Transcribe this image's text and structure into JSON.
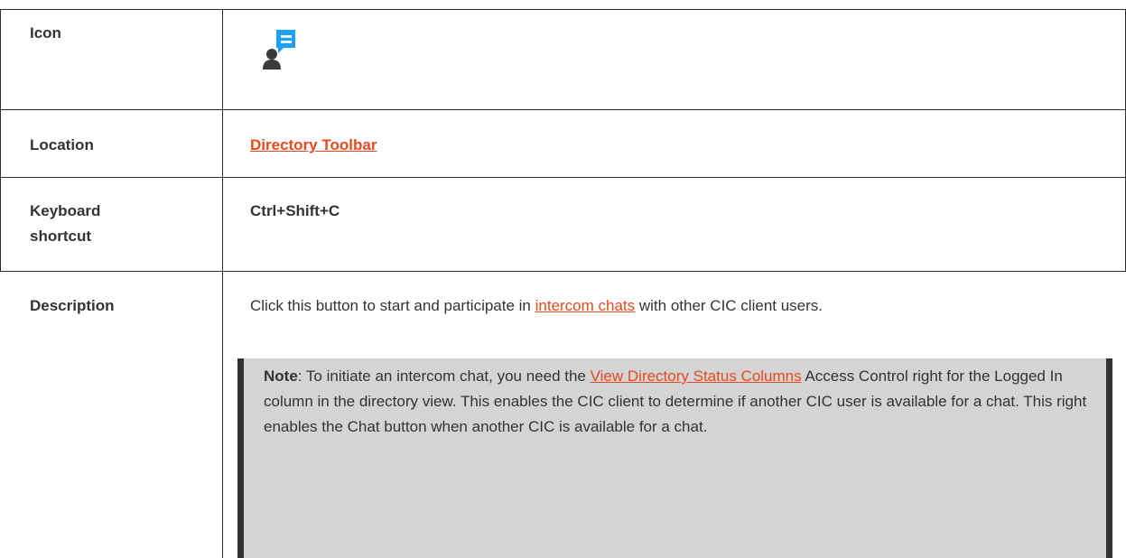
{
  "rows": {
    "icon": {
      "label": "Icon",
      "icon_name": "chat-user-icon"
    },
    "location": {
      "label": "Location",
      "link_text": "Directory Toolbar"
    },
    "shortcut": {
      "label_line1": "Keyboard",
      "label_line2": "shortcut",
      "value": "Ctrl+Shift+C"
    },
    "description": {
      "label": "Description",
      "text_before": "Click this button to start and participate in ",
      "link_text": "intercom chats",
      "text_after": " with other CIC client users."
    }
  },
  "note": {
    "label": "Note",
    "text_before": ": To initiate an intercom chat, you need the ",
    "link_text": "View Directory Status Columns",
    "text_after": " Access Control right for the Logged In column in the directory view. This enables the CIC client to determine if another CIC user is available for a chat. This right enables the Chat button when another CIC is available for a chat."
  },
  "colors": {
    "link": "#e8491d",
    "note_bg": "#d4d4d4",
    "note_bar": "#333333",
    "icon_bubble": "#1da1f2",
    "icon_person": "#3a3a3a"
  }
}
